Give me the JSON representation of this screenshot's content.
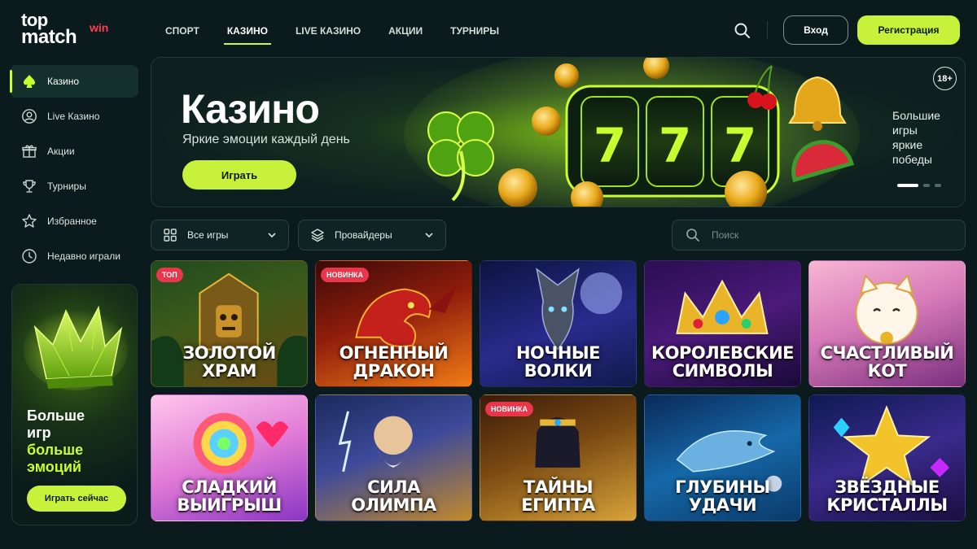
{
  "logo": {
    "line1": "top",
    "line2": "match",
    "accent": "win"
  },
  "nav": [
    {
      "label": "СПОРТ",
      "active": false
    },
    {
      "label": "КАЗИНО",
      "active": true
    },
    {
      "label": "LIVE КАЗИНО",
      "active": false
    },
    {
      "label": "АКЦИИ",
      "active": false
    },
    {
      "label": "ТУРНИРЫ",
      "active": false
    }
  ],
  "header": {
    "search_icon": "search-icon",
    "login_label": "Вход",
    "register_label": "Регистрация"
  },
  "sidebar": {
    "items": [
      {
        "label": "Казино",
        "icon": "spade-icon",
        "active": true
      },
      {
        "label": "Live Казино",
        "icon": "user-icon",
        "active": false
      },
      {
        "label": "Акции",
        "icon": "gift-icon",
        "active": false
      },
      {
        "label": "Турниры",
        "icon": "trophy-icon",
        "active": false
      },
      {
        "label": "Избранное",
        "icon": "star-icon",
        "active": false
      },
      {
        "label": "Недавно играли",
        "icon": "clock-icon",
        "active": false
      }
    ],
    "promo": {
      "line1": "Больше",
      "line2": "игр",
      "line3": "больше",
      "line4": "эмоций",
      "button": "Играть сейчас"
    }
  },
  "hero": {
    "title": "Казино",
    "subtitle": "Яркие эмоции каждый день",
    "button": "Играть",
    "age": "18+",
    "side_line1": "Большие",
    "side_line2": "игры",
    "side_line3": "яркие",
    "side_line4": "победы",
    "slides": 3,
    "active_slide": 1
  },
  "filters": {
    "all_games": "Все игры",
    "providers": "Провайдеры",
    "search_placeholder": "Поиск"
  },
  "games": [
    {
      "line1": "Золотой",
      "line2": "храм",
      "badge": "ТОП",
      "badge_color": "#e8364a",
      "theme": "temple"
    },
    {
      "line1": "Огненный",
      "line2": "дракон",
      "badge": "НОВИНКА",
      "badge_color": "#e8364a",
      "theme": "dragon"
    },
    {
      "line1": "Ночные",
      "line2": "волки",
      "badge": "",
      "badge_color": "",
      "theme": "wolf"
    },
    {
      "line1": "Королевские",
      "line2": "символы",
      "badge": "",
      "badge_color": "",
      "theme": "crown"
    },
    {
      "line1": "Счастливый",
      "line2": "кот",
      "badge": "",
      "badge_color": "",
      "theme": "cat"
    },
    {
      "line1": "Сладкий",
      "line2": "выигрыш",
      "badge": "",
      "badge_color": "",
      "theme": "candy"
    },
    {
      "line1": "Сила",
      "line2": "Олимпа",
      "badge": "",
      "badge_color": "",
      "theme": "zeus"
    },
    {
      "line1": "Тайны",
      "line2": "Египта",
      "badge": "НОВИНКА",
      "badge_color": "#e8364a",
      "theme": "egypt"
    },
    {
      "line1": "Глубины",
      "line2": "удачи",
      "badge": "",
      "badge_color": "",
      "theme": "ocean"
    },
    {
      "line1": "Звёздные",
      "line2": "кристаллы",
      "badge": "",
      "badge_color": "",
      "theme": "star"
    }
  ],
  "colors": {
    "accent": "#c7f13a",
    "background": "#0b1a1d",
    "badge": "#e8364a",
    "logo_accent": "#ff3d52"
  }
}
